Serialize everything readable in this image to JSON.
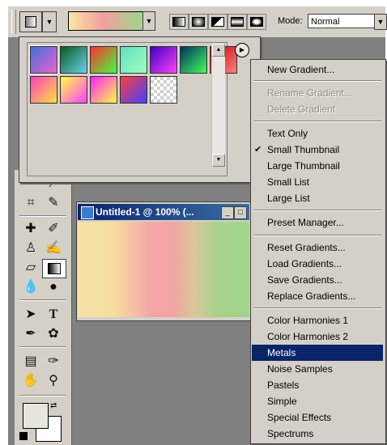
{
  "options_bar": {
    "mode_label": "Mode:",
    "mode_value": "Normal"
  },
  "document": {
    "title": "Untitled-1 @ 100% (..."
  },
  "picker": {
    "swatches": [
      [
        "#3a74d8",
        "#f060d0"
      ],
      [
        "#0c5a1a",
        "#6ad0f0"
      ],
      [
        "#ff3030",
        "#40ff40"
      ],
      [
        "#60e0c0",
        "#a0ffc0"
      ],
      [
        "#4000c0",
        "#ff40ff"
      ],
      [
        "#003060",
        "#40ff60"
      ],
      [
        "#c00000",
        "#ff8080"
      ],
      [
        "#ff40c0",
        "#ffe040"
      ],
      [
        "#ffff40",
        "#ff40ff"
      ],
      [
        "#ff20ff",
        "#ffff40"
      ],
      [
        "#ff4040",
        "#4040ff"
      ],
      [
        "#e0e0e0",
        "#ffffff"
      ]
    ]
  },
  "menu": {
    "items": [
      {
        "label": "New Gradient...",
        "state": "normal"
      },
      {
        "label": "Rename Gradient...",
        "state": "disabled"
      },
      {
        "label": "Delete Gradient",
        "state": "disabled"
      },
      {
        "label": "Text Only",
        "state": "normal"
      },
      {
        "label": "Small Thumbnail",
        "state": "checked"
      },
      {
        "label": "Large Thumbnail",
        "state": "normal"
      },
      {
        "label": "Small List",
        "state": "normal"
      },
      {
        "label": "Large List",
        "state": "normal"
      },
      {
        "label": "Preset Manager...",
        "state": "normal"
      },
      {
        "label": "Reset Gradients...",
        "state": "normal"
      },
      {
        "label": "Load Gradients...",
        "state": "normal"
      },
      {
        "label": "Save Gradients...",
        "state": "normal"
      },
      {
        "label": "Replace Gradients...",
        "state": "normal"
      },
      {
        "label": "Color Harmonies 1",
        "state": "normal"
      },
      {
        "label": "Color Harmonies 2",
        "state": "normal"
      },
      {
        "label": "Metals",
        "state": "highlighted"
      },
      {
        "label": "Noise Samples",
        "state": "normal"
      },
      {
        "label": "Pastels",
        "state": "normal"
      },
      {
        "label": "Simple",
        "state": "normal"
      },
      {
        "label": "Special Effects",
        "state": "normal"
      },
      {
        "label": "Spectrums",
        "state": "normal"
      }
    ]
  }
}
